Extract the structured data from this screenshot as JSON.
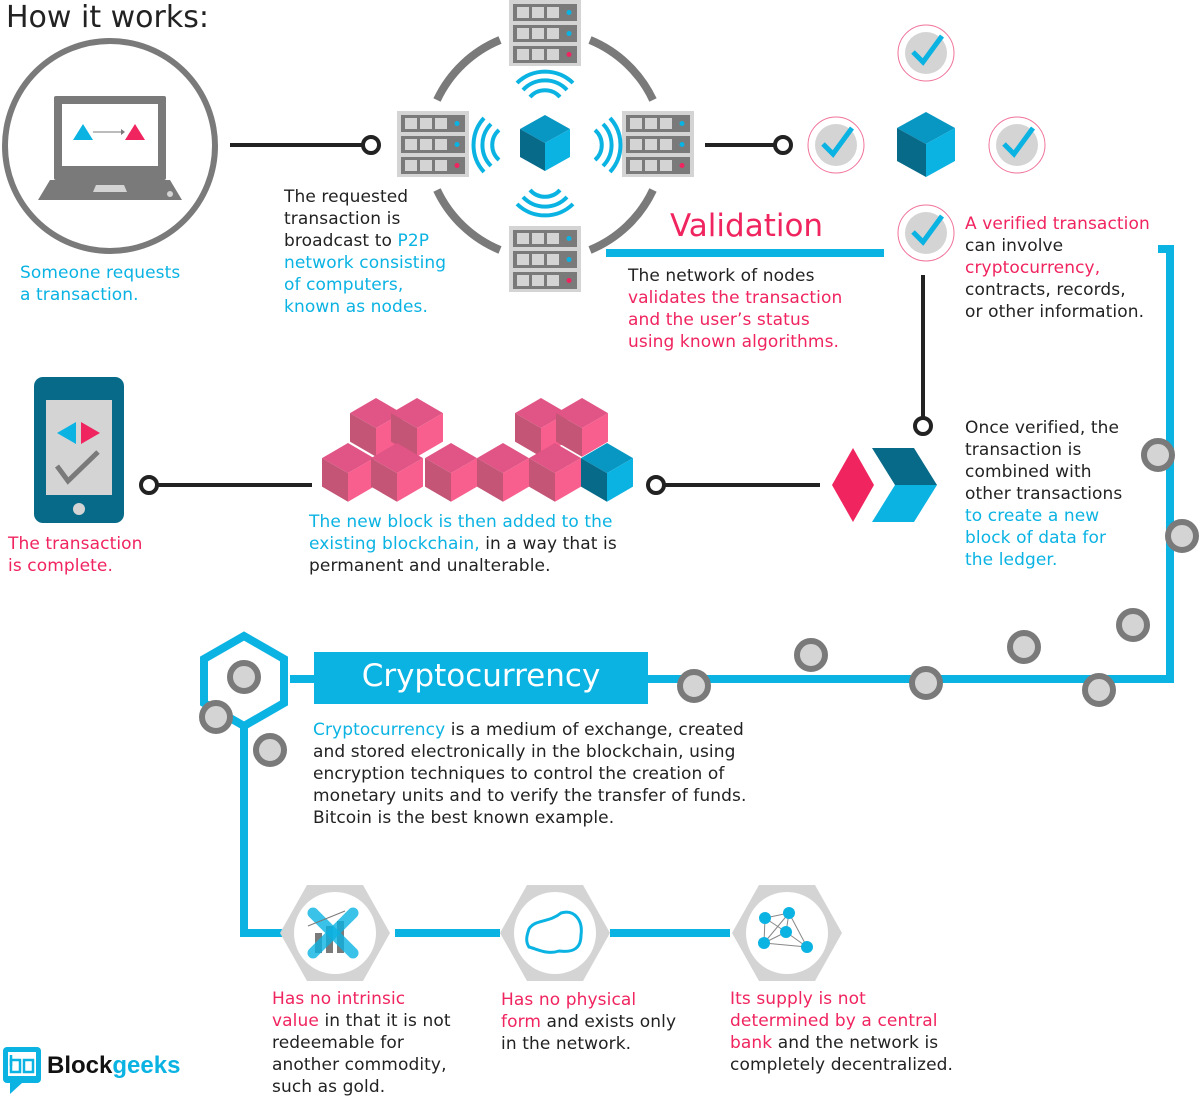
{
  "header": {
    "title": "How it works:"
  },
  "colors": {
    "blue": "#0bb3e3",
    "pink": "#f0245f",
    "gray": "#7a7a7a",
    "light_gray": "#d4d4d4",
    "dark_teal": "#076a89",
    "block_pink": "#f85e8e",
    "text": "#222222"
  },
  "steps": {
    "request": {
      "text": "Someone requests a transaction.",
      "lines": [
        "Someone requests",
        "a transaction."
      ]
    },
    "broadcast": {
      "lines": [
        {
          "segments": [
            {
              "text": "The requested",
              "color": "dark"
            }
          ]
        },
        {
          "segments": [
            {
              "text": "transaction is",
              "color": "dark"
            }
          ]
        },
        {
          "segments": [
            {
              "text": "broadcast to ",
              "color": "dark"
            },
            {
              "text": "P2P",
              "color": "blue"
            }
          ]
        },
        {
          "segments": [
            {
              "text": "network consisting",
              "color": "blue"
            }
          ]
        },
        {
          "segments": [
            {
              "text": "of computers,",
              "color": "blue"
            }
          ]
        },
        {
          "segments": [
            {
              "text": "known as nodes.",
              "color": "blue"
            }
          ]
        }
      ]
    },
    "validation": {
      "title": "Validation",
      "lines": [
        {
          "segments": [
            {
              "text": "The network of nodes",
              "color": "dark"
            }
          ]
        },
        {
          "segments": [
            {
              "text": "validates the transaction",
              "color": "pink"
            }
          ]
        },
        {
          "segments": [
            {
              "text": "and the user’s status",
              "color": "pink"
            }
          ]
        },
        {
          "segments": [
            {
              "text": "using known algorithms.",
              "color": "pink"
            }
          ]
        }
      ]
    },
    "verified": {
      "lines": [
        {
          "segments": [
            {
              "text": "A verified transaction",
              "color": "pink"
            }
          ]
        },
        {
          "segments": [
            {
              "text": "can involve",
              "color": "dark"
            }
          ]
        },
        {
          "segments": [
            {
              "text": "cryptocurrency,",
              "color": "pink"
            }
          ]
        },
        {
          "segments": [
            {
              "text": "contracts, records,",
              "color": "dark"
            }
          ]
        },
        {
          "segments": [
            {
              "text": "or other information.",
              "color": "dark"
            }
          ]
        }
      ]
    },
    "combined": {
      "lines": [
        {
          "segments": [
            {
              "text": "Once verified, the",
              "color": "dark"
            }
          ]
        },
        {
          "segments": [
            {
              "text": "transaction is",
              "color": "dark"
            }
          ]
        },
        {
          "segments": [
            {
              "text": "combined with",
              "color": "dark"
            }
          ]
        },
        {
          "segments": [
            {
              "text": "other transactions",
              "color": "dark"
            }
          ]
        },
        {
          "segments": [
            {
              "text": "to create a new",
              "color": "blue"
            }
          ]
        },
        {
          "segments": [
            {
              "text": "block of data for",
              "color": "blue"
            }
          ]
        },
        {
          "segments": [
            {
              "text": "the ledger.",
              "color": "blue"
            }
          ]
        }
      ]
    },
    "added": {
      "lines": [
        {
          "segments": [
            {
              "text": "The new block is then added to the",
              "color": "blue"
            }
          ]
        },
        {
          "segments": [
            {
              "text": "existing blockchain,",
              "color": "blue"
            },
            {
              "text": " in a way that is",
              "color": "dark"
            }
          ]
        },
        {
          "segments": [
            {
              "text": "permanent and unalterable.",
              "color": "dark"
            }
          ]
        }
      ]
    },
    "complete": {
      "lines": [
        "The transaction",
        "is complete."
      ]
    }
  },
  "cryptocurrency": {
    "title": "Cryptocurrency",
    "lines": [
      {
        "segments": [
          {
            "text": "Cryptocurrency",
            "color": "blue"
          },
          {
            "text": " is a medium of exchange, created",
            "color": "dark"
          }
        ]
      },
      {
        "segments": [
          {
            "text": "and stored electronically in the blockchain, using",
            "color": "dark"
          }
        ]
      },
      {
        "segments": [
          {
            "text": "encryption techniques to control the creation of",
            "color": "dark"
          }
        ]
      },
      {
        "segments": [
          {
            "text": "monetary units and to verify the transfer of funds.",
            "color": "dark"
          }
        ]
      },
      {
        "segments": [
          {
            "text": "Bitcoin is the best known example.",
            "color": "dark"
          }
        ]
      }
    ],
    "properties": [
      {
        "icon": "no-value-chart-icon",
        "lines": [
          {
            "segments": [
              {
                "text": "Has no intrinsic",
                "color": "pink"
              }
            ]
          },
          {
            "segments": [
              {
                "text": "value",
                "color": "pink"
              },
              {
                "text": " in that it is not",
                "color": "dark"
              }
            ]
          },
          {
            "segments": [
              {
                "text": "redeemable for",
                "color": "dark"
              }
            ]
          },
          {
            "segments": [
              {
                "text": "another commodity,",
                "color": "dark"
              }
            ]
          },
          {
            "segments": [
              {
                "text": "such as gold.",
                "color": "dark"
              }
            ]
          }
        ]
      },
      {
        "icon": "no-physical-form-icon",
        "lines": [
          {
            "segments": [
              {
                "text": "Has no physical",
                "color": "pink"
              }
            ]
          },
          {
            "segments": [
              {
                "text": "form",
                "color": "pink"
              },
              {
                "text": " and exists only",
                "color": "dark"
              }
            ]
          },
          {
            "segments": [
              {
                "text": "in the network.",
                "color": "dark"
              }
            ]
          }
        ]
      },
      {
        "icon": "decentralized-network-icon",
        "lines": [
          {
            "segments": [
              {
                "text": "Its supply is not",
                "color": "pink"
              }
            ]
          },
          {
            "segments": [
              {
                "text": "determined by a central",
                "color": "pink"
              }
            ]
          },
          {
            "segments": [
              {
                "text": "bank",
                "color": "pink"
              },
              {
                "text": " and the network is",
                "color": "dark"
              }
            ]
          },
          {
            "segments": [
              {
                "text": "completely decentralized.",
                "color": "dark"
              }
            ]
          }
        ]
      }
    ]
  },
  "logo": {
    "part1": "Block",
    "part2": "geeks",
    "mark": "bg"
  }
}
